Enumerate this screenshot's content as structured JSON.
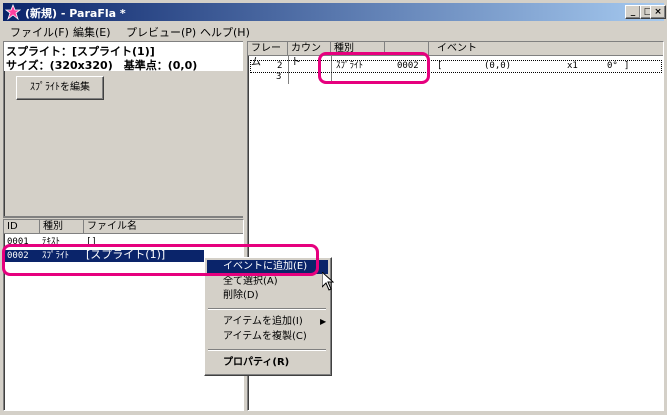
{
  "window": {
    "title": "(新規) - ParaFla *"
  },
  "caption_buttons": {
    "minimize": "_",
    "maximize": "□",
    "close": "×"
  },
  "menu": [
    {
      "label": "ファイル(F)"
    },
    {
      "label": "編集(E)"
    },
    {
      "label": "プレビュー(P)"
    },
    {
      "label": "ヘルプ(H)"
    }
  ],
  "sprite_panel": {
    "title": "スプライト：[スプライト(1)]",
    "size_line": "サイズ：(320x320)　基準点：(0,0)",
    "edit_button": "ｽﾌﾟﾗｲﾄを編集"
  },
  "items_table": {
    "headers": [
      "ID",
      "種別",
      "ファイル名"
    ],
    "rows": [
      {
        "id": "0001",
        "type": "ﾃｷｽﾄ",
        "file": "[]"
      },
      {
        "id": "0002",
        "type": "ｽﾌﾟﾗｲﾄ",
        "file": "[スプライト(1)]"
      }
    ]
  },
  "timeline": {
    "headers": [
      "フレーム",
      "カウント",
      "種別",
      "",
      "イベント"
    ],
    "rows": [
      {
        "frame": "2",
        "count": "",
        "type": "ｽﾌﾟﾗｲﾄ",
        "id": "0002",
        "sep": "[",
        "pos": "(0,0)",
        "scale": "x1",
        "angle": "0°",
        "end": "]"
      },
      {
        "frame": "3",
        "count": "",
        "type": "",
        "id": "",
        "sep": "",
        "pos": "",
        "scale": "",
        "angle": "",
        "end": ""
      }
    ]
  },
  "context_menu": {
    "add_to_event": "イベントに追加(E)",
    "select_all": "全て選択(A)",
    "delete": "削除(D)",
    "add_item": "アイテムを追加(I)",
    "duplicate_item": "アイテムを複製(C)",
    "properties": "プロパティ(R)"
  },
  "colors": {
    "highlight": "#e6007e",
    "selection": "#0a246a",
    "titlebar": "#0a246a"
  }
}
